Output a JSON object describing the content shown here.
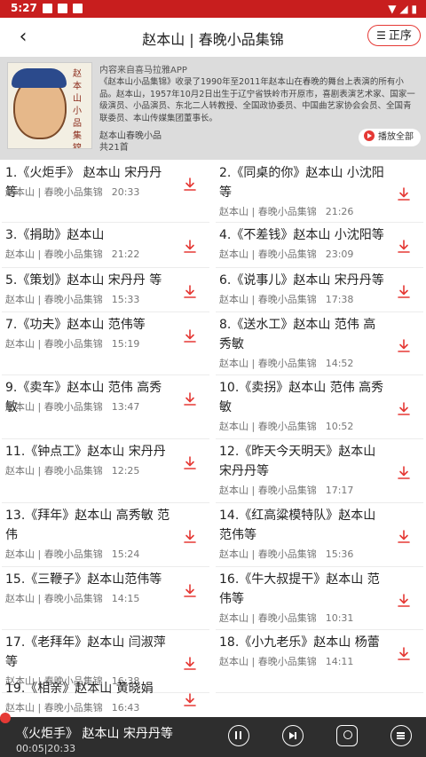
{
  "status": {
    "time": "5:27"
  },
  "header": {
    "title": "赵本山 | 春晚小品集锦",
    "sort_label": "正序"
  },
  "album": {
    "source": "内容来自喜马拉雅APP",
    "description": "《赵本山小品集锦》收录了1990年至2011年赵本山在春晚的舞台上表演的所有小品。赵本山，1957年10月2日出生于辽宁省铁岭市开原市，喜剧表演艺术家、国家一级演员、小品演员、东北二人转教授、全国政协委员、中国曲艺家协会会员、全国青联委员、本山传媒集团董事长。",
    "cover_text": "赵本山小品集锦",
    "author": "赵本山春晚小品",
    "count": "共21首",
    "play_all": "播放全部"
  },
  "tracks": [
    {
      "title": "1.《火炬手》 赵本山 宋丹丹等",
      "meta": "赵本山 | 春晚小品集锦",
      "duration": "20:33"
    },
    {
      "title": "2.《同桌的你》赵本山 小沈阳等",
      "meta": "赵本山 | 春晚小品集锦",
      "duration": "21:26"
    },
    {
      "title": "3.《捐助》赵本山",
      "meta": "赵本山 | 春晚小品集锦",
      "duration": "21:22"
    },
    {
      "title": "4.《不差钱》赵本山 小沈阳等",
      "meta": "赵本山 | 春晚小品集锦",
      "duration": "23:09"
    },
    {
      "title": "5.《策划》赵本山 宋丹丹 等",
      "meta": "赵本山 | 春晚小品集锦",
      "duration": "15:33"
    },
    {
      "title": "6.《说事儿》赵本山 宋丹丹等",
      "meta": "赵本山 | 春晚小品集锦",
      "duration": "17:38"
    },
    {
      "title": "7.《功夫》赵本山 范伟等",
      "meta": "赵本山 | 春晚小品集锦",
      "duration": "15:19"
    },
    {
      "title": "8.《送水工》赵本山 范伟 高秀敏",
      "meta": "赵本山 | 春晚小品集锦",
      "duration": "14:52"
    },
    {
      "title": "9.《卖车》赵本山 范伟 高秀敏",
      "meta": "赵本山 | 春晚小品集锦",
      "duration": "13:47"
    },
    {
      "title": "10.《卖拐》赵本山 范伟 高秀敏",
      "meta": "赵本山 | 春晚小品集锦",
      "duration": "10:52"
    },
    {
      "title": "11.《钟点工》赵本山 宋丹丹",
      "meta": "赵本山 | 春晚小品集锦",
      "duration": "12:25"
    },
    {
      "title": "12.《昨天今天明天》赵本山 宋丹丹等",
      "meta": "赵本山 | 春晚小品集锦",
      "duration": "17:17"
    },
    {
      "title": "13.《拜年》赵本山 高秀敏 范伟",
      "meta": "赵本山 | 春晚小品集锦",
      "duration": "15:24"
    },
    {
      "title": "14.《红高粱模特队》赵本山 范伟等",
      "meta": "赵本山 | 春晚小品集锦",
      "duration": "15:36"
    },
    {
      "title": "15.《三鞭子》赵本山范伟等",
      "meta": "赵本山 | 春晚小品集锦",
      "duration": "14:15"
    },
    {
      "title": "16.《牛大叔提干》赵本山 范伟等",
      "meta": "赵本山 | 春晚小品集锦",
      "duration": "10:31"
    },
    {
      "title": "17.《老拜年》赵本山 闫淑萍等",
      "meta": "赵本山 | 春晚小品集锦",
      "duration": "16:38"
    },
    {
      "title": "18.《小九老乐》赵本山 杨蕾",
      "meta": "赵本山 | 春晚小品集锦",
      "duration": "14:11"
    },
    {
      "title": "19.《相亲》赵本山 黄晓娟",
      "meta": "赵本山 | 春晚小品集锦",
      "duration": "16:43"
    }
  ],
  "player": {
    "title": "《火炬手》 赵本山 宋丹丹等",
    "time": "00:05|20:33"
  },
  "colors": {
    "accent": "#e53935",
    "statusbar": "#c81e1e",
    "player_bg": "#2e2e2e"
  }
}
